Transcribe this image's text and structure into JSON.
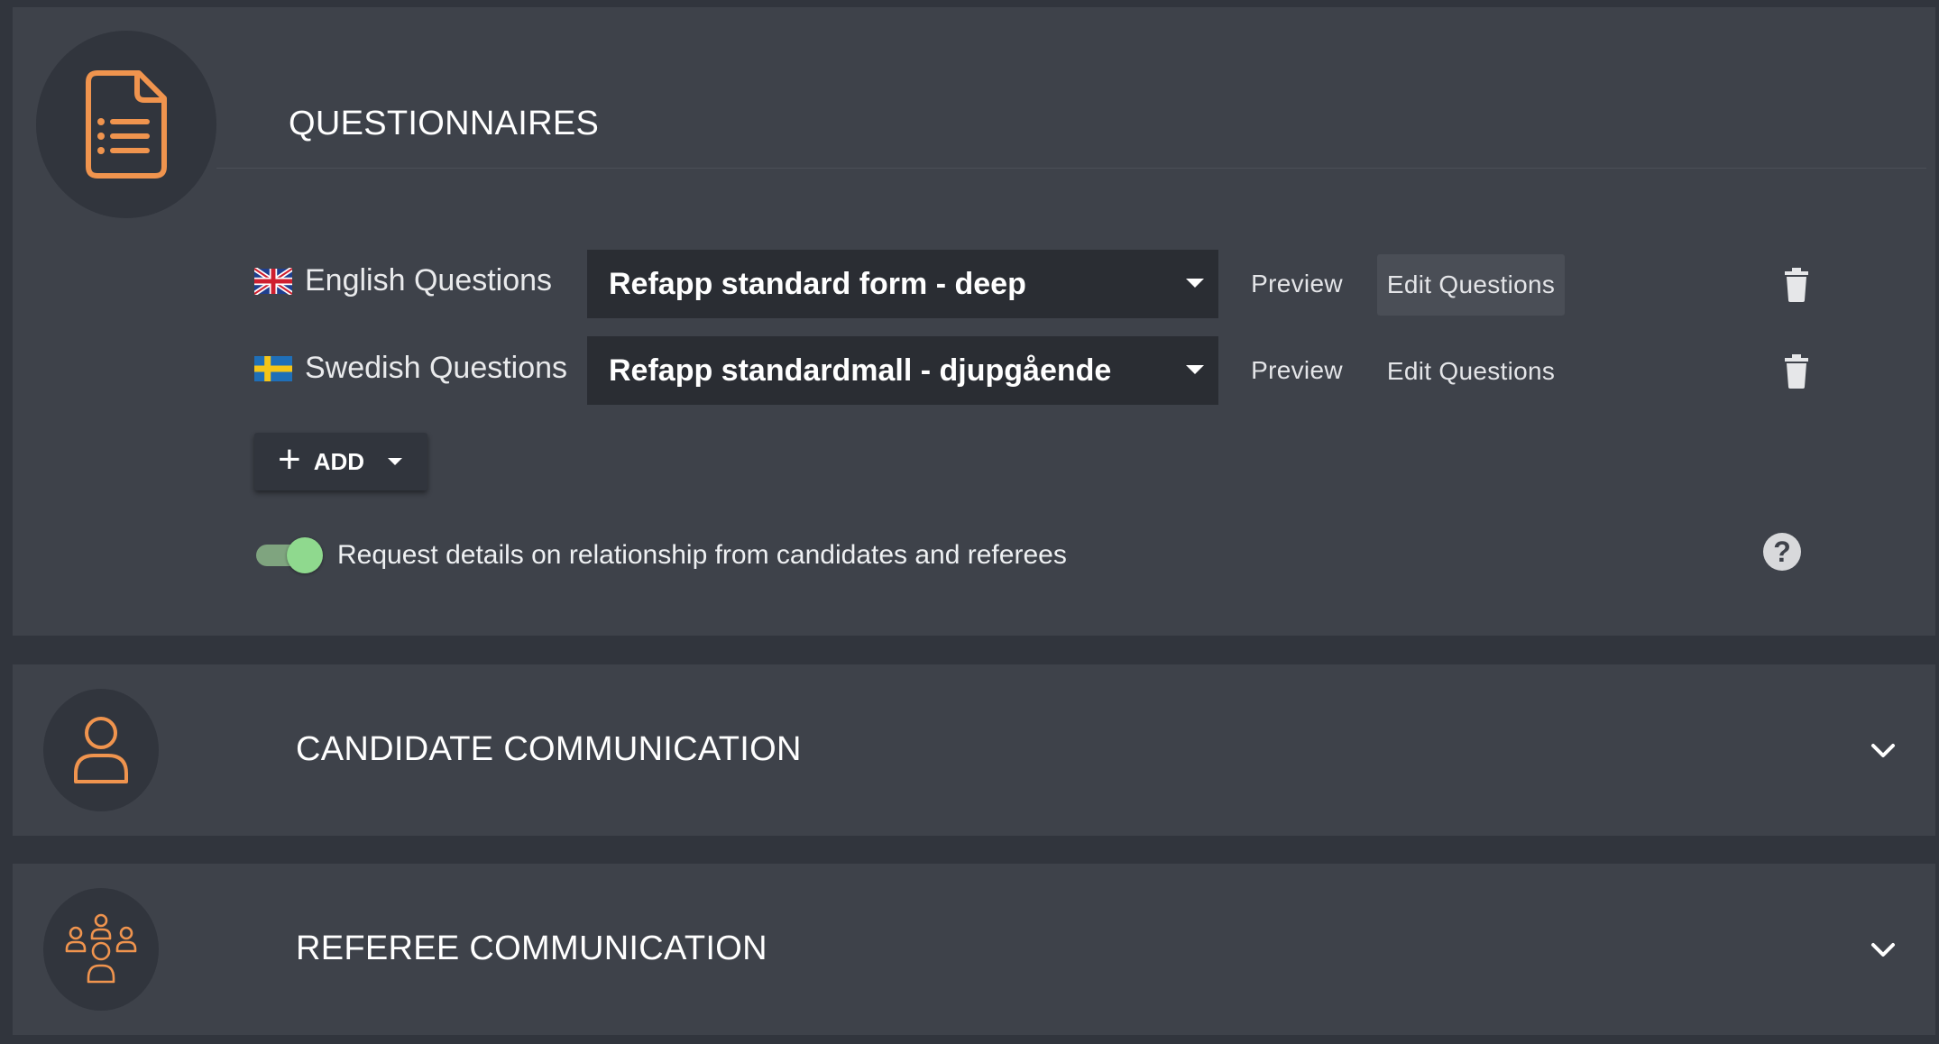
{
  "questionnaires": {
    "title": "QUESTIONNAIRES",
    "icon": "document-list-icon",
    "rows": [
      {
        "label": "English Questions",
        "flag": "uk-flag-icon",
        "selected_form": "Refapp standard form - deep",
        "preview_label": "Preview",
        "edit_label": "Edit Questions"
      },
      {
        "label": "Swedish Questions",
        "flag": "sweden-flag-icon",
        "selected_form": "Refapp standardmall - djupgående",
        "preview_label": "Preview",
        "edit_label": "Edit Questions"
      }
    ],
    "add_label": "ADD",
    "toggle": {
      "label": "Request details on relationship from candidates and referees",
      "on": true
    },
    "help_glyph": "?"
  },
  "candidate_communication": {
    "title": "CANDIDATE COMMUNICATION",
    "icon": "person-icon"
  },
  "referee_communication": {
    "title": "REFEREE COMMUNICATION",
    "icon": "group-icon"
  },
  "colors": {
    "accent": "#f0944e",
    "panel": "#3e424a",
    "background": "#31353d",
    "toggle_on": "#8fd98e"
  }
}
